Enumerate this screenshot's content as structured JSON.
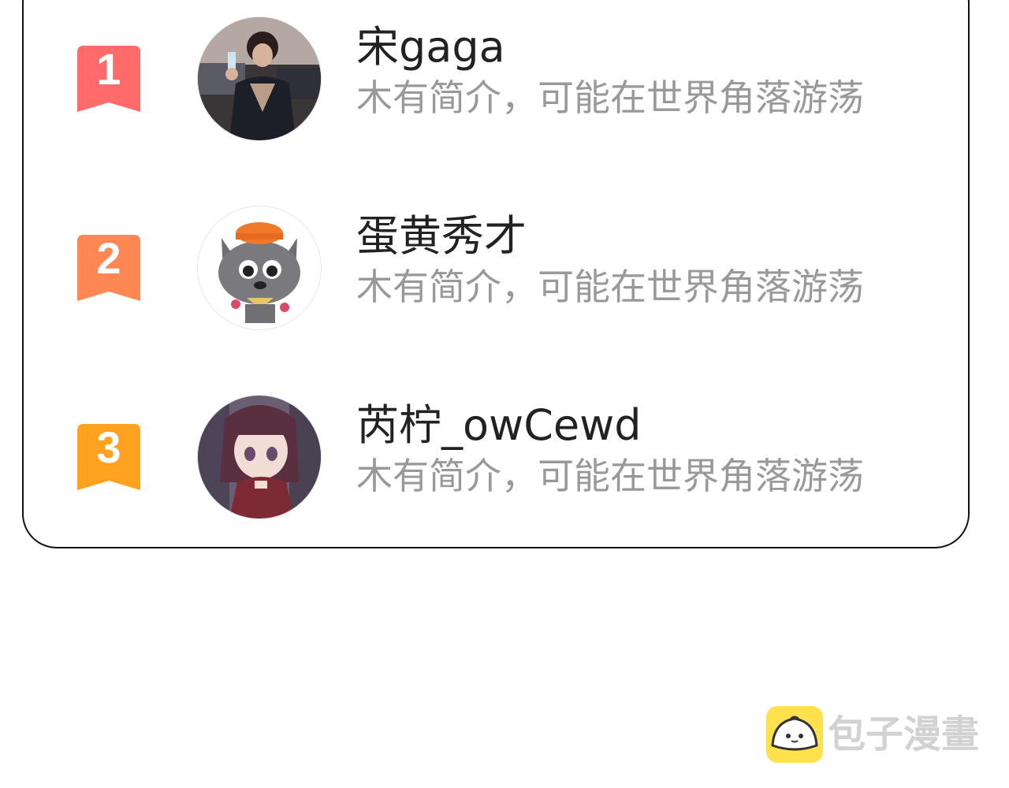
{
  "ranking": {
    "entries": [
      {
        "rank": "1",
        "name": "宋gaga",
        "bio": "木有简介，可能在世界角落游荡",
        "badge_color": "#ff6a6a",
        "avatar_icon": "person-photo-avatar"
      },
      {
        "rank": "2",
        "name": "蛋黄秀才",
        "bio": "木有简介，可能在世界角落游荡",
        "badge_color": "#ff8754",
        "avatar_icon": "grey-wolf-cartoon-avatar"
      },
      {
        "rank": "3",
        "name": "芮柠_owCewd",
        "bio": "木有简介，可能在世界角落游荡",
        "badge_color": "#ffa21f",
        "avatar_icon": "anime-girl-avatar"
      }
    ]
  },
  "watermark": {
    "text": "包子漫畫",
    "logo_color": "#ffe14d",
    "logo_icon": "steamed-bun-icon"
  }
}
